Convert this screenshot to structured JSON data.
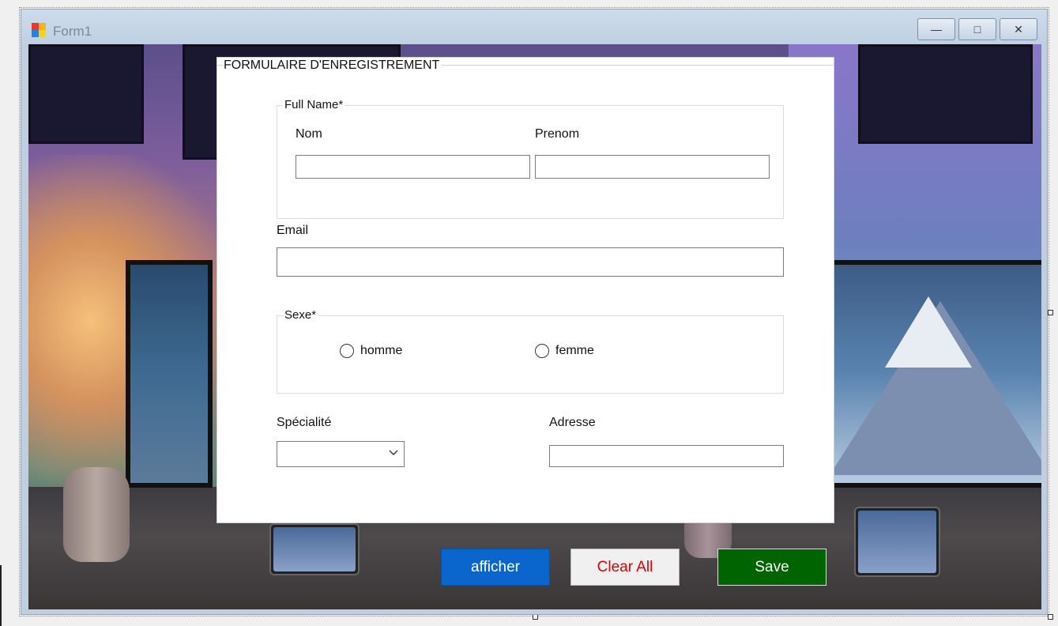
{
  "window": {
    "title": "Form1",
    "controls": {
      "minimize": "—",
      "maximize": "□",
      "close": "✕"
    }
  },
  "form": {
    "title": "FORMULAIRE D'ENREGISTREMENT",
    "full_name": {
      "caption": "Full Name*",
      "nom_label": "Nom",
      "prenom_label": "Prenom",
      "nom_value": "",
      "prenom_value": ""
    },
    "email": {
      "label": "Email",
      "value": ""
    },
    "sexe": {
      "caption": "Sexe*",
      "options": [
        "homme",
        "femme"
      ]
    },
    "specialite": {
      "label": "Spécialité",
      "selected": ""
    },
    "adresse": {
      "label": "Adresse",
      "value": ""
    }
  },
  "buttons": {
    "afficher": {
      "label": "afficher",
      "bg": "#0a66cc",
      "fg": "#ffffff"
    },
    "clear_all": {
      "label": "Clear All",
      "bg": "#f0f0f0",
      "fg": "#e00000"
    },
    "save": {
      "label": "Save",
      "bg": "#006400",
      "fg": "#ffffff"
    }
  },
  "icons": {
    "app": "form-app-icon",
    "combo_arrow": "chevron-down-icon",
    "radio": "radio-icon"
  }
}
